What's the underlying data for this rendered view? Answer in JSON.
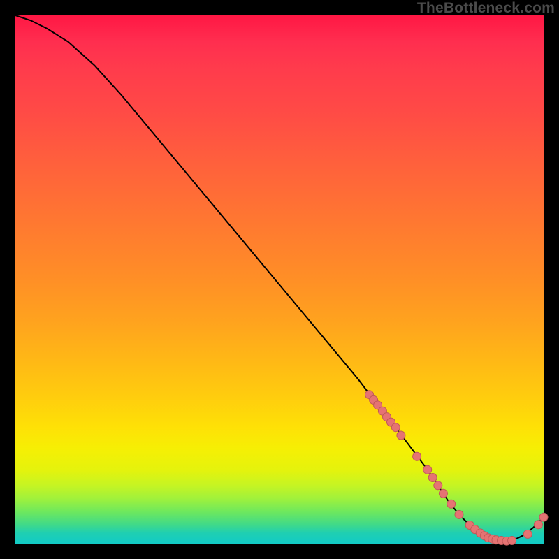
{
  "watermark": "TheBottleneck.com",
  "colors": {
    "page_bg": "#000000",
    "gradient_top": "#ff1744",
    "gradient_mid": "#ffd400",
    "gradient_bottom": "#12cbc6",
    "curve": "#000000",
    "dots": "#e57373"
  },
  "chart_data": {
    "type": "line",
    "title": "",
    "xlabel": "",
    "ylabel": "",
    "xlim": [
      0,
      100
    ],
    "ylim": [
      0,
      100
    ],
    "grid": false,
    "legend": false,
    "series": [
      {
        "name": "bottleneck-curve",
        "x": [
          0,
          3,
          6,
          10,
          15,
          20,
          25,
          30,
          35,
          40,
          45,
          50,
          55,
          60,
          65,
          68,
          70,
          72,
          75,
          78,
          80,
          82,
          84,
          86,
          88,
          90,
          92,
          94,
          96,
          98,
          100
        ],
        "y": [
          100,
          99,
          97.5,
          95,
          90.5,
          85,
          79,
          73,
          67,
          61,
          55,
          49,
          43,
          37,
          31,
          27,
          24.5,
          22,
          18,
          14,
          11,
          8,
          5.5,
          3.5,
          2,
          1,
          0.5,
          0.5,
          1.5,
          3,
          5
        ]
      }
    ],
    "marker_points": [
      {
        "x": 67,
        "y": 28.2
      },
      {
        "x": 67.8,
        "y": 27.2
      },
      {
        "x": 68.6,
        "y": 26.2
      },
      {
        "x": 69.5,
        "y": 25.1
      },
      {
        "x": 70.3,
        "y": 24.0
      },
      {
        "x": 71.1,
        "y": 23.0
      },
      {
        "x": 72.0,
        "y": 22.0
      },
      {
        "x": 73.0,
        "y": 20.5
      },
      {
        "x": 76.0,
        "y": 16.5
      },
      {
        "x": 78.0,
        "y": 14.0
      },
      {
        "x": 79.0,
        "y": 12.5
      },
      {
        "x": 80.0,
        "y": 11.0
      },
      {
        "x": 81.0,
        "y": 9.5
      },
      {
        "x": 82.5,
        "y": 7.5
      },
      {
        "x": 84.0,
        "y": 5.5
      },
      {
        "x": 86.0,
        "y": 3.5
      },
      {
        "x": 87.0,
        "y": 2.7
      },
      {
        "x": 88.0,
        "y": 2.0
      },
      {
        "x": 88.8,
        "y": 1.5
      },
      {
        "x": 89.5,
        "y": 1.1
      },
      {
        "x": 90.3,
        "y": 0.9
      },
      {
        "x": 91.0,
        "y": 0.7
      },
      {
        "x": 92.0,
        "y": 0.6
      },
      {
        "x": 93.0,
        "y": 0.5
      },
      {
        "x": 94.0,
        "y": 0.6
      },
      {
        "x": 97.0,
        "y": 1.8
      },
      {
        "x": 99.0,
        "y": 3.6
      },
      {
        "x": 100.0,
        "y": 5.0
      }
    ]
  }
}
